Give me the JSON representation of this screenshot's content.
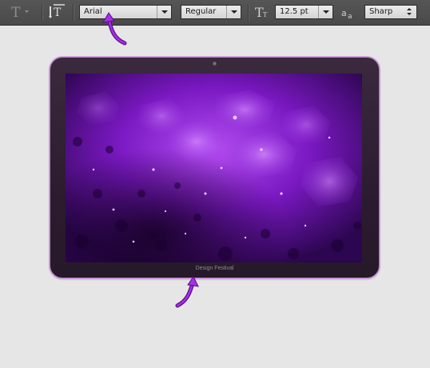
{
  "options_bar": {
    "tool_icon": "text-tool-icon",
    "orientation_icon": "text-orientation-icon",
    "font_family": "Arial",
    "font_style": "Regular",
    "size_icon": "font-size-icon",
    "font_size": "12.5 pt",
    "antialias_icon": "antialias-icon",
    "antialias": "Sharp"
  },
  "canvas": {
    "device_label": "Design Festival"
  },
  "colors": {
    "accent_purple": "#8a22c8",
    "screen_purple": "#6a12b0",
    "bezel": "#2d1e31"
  }
}
